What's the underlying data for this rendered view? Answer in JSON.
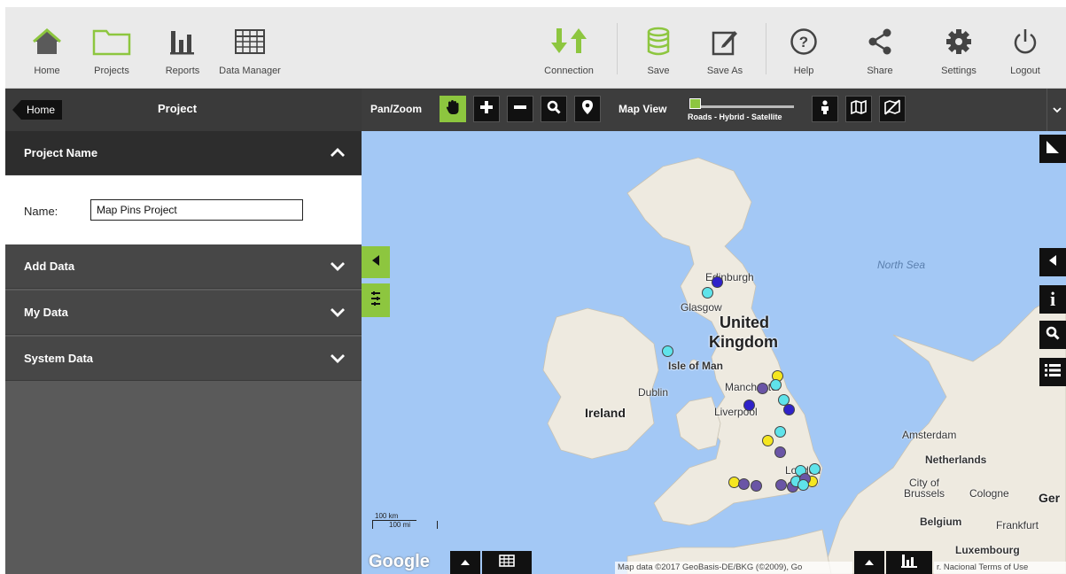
{
  "toolbar": {
    "home": "Home",
    "projects": "Projects",
    "reports": "Reports",
    "data_manager": "Data Manager",
    "connection": "Connection",
    "save": "Save",
    "save_as": "Save As",
    "help": "Help",
    "share": "Share",
    "settings": "Settings",
    "logout": "Logout"
  },
  "subbar": {
    "home_tag": "Home",
    "project_title": "Project",
    "pan_zoom": "Pan/Zoom",
    "map_view": "Map View",
    "slider_label": "Roads - Hybrid - Satellite"
  },
  "sidebar": {
    "project_name_header": "Project Name",
    "name_label": "Name:",
    "name_value": "Map Pins Project",
    "sections": [
      "Add Data",
      "My Data",
      "System Data"
    ]
  },
  "map": {
    "places": {
      "north_sea": "North Sea",
      "edinburgh": "Edinburgh",
      "glasgow": "Glasgow",
      "uk_line1": "United",
      "uk_line2": "Kingdom",
      "isle_of_man": "Isle of Man",
      "dublin": "Dublin",
      "ireland": "Ireland",
      "manchester": "Manchester",
      "liverpool": "Liverpool",
      "london": "London",
      "amsterdam": "Amsterdam",
      "netherlands": "Netherlands",
      "city_of_brussels": "City of",
      "brussels": "Brussels",
      "cologne": "Cologne",
      "belgium": "Belgium",
      "frankfurt": "Frankfurt",
      "luxembourg": "Luxembourg",
      "germany_partial": "Ger"
    },
    "scale_km": "100 km",
    "scale_mi": "100 mi",
    "google": "Google",
    "attribution": "Map data ©2017 GeoBasis-DE/BKG (©2009), Go",
    "attribution_right": "r. Nacional   Terms of Use"
  },
  "colors": {
    "accent_green": "#8dc63f",
    "dark_bar": "#3b3b3b",
    "water": "#a3c8f5",
    "land": "#eeeae0",
    "pin_yellow": "#f5e620",
    "pin_cyan": "#5fe3ea",
    "pin_purple": "#6a55a6",
    "pin_blue": "#2f22c9"
  }
}
